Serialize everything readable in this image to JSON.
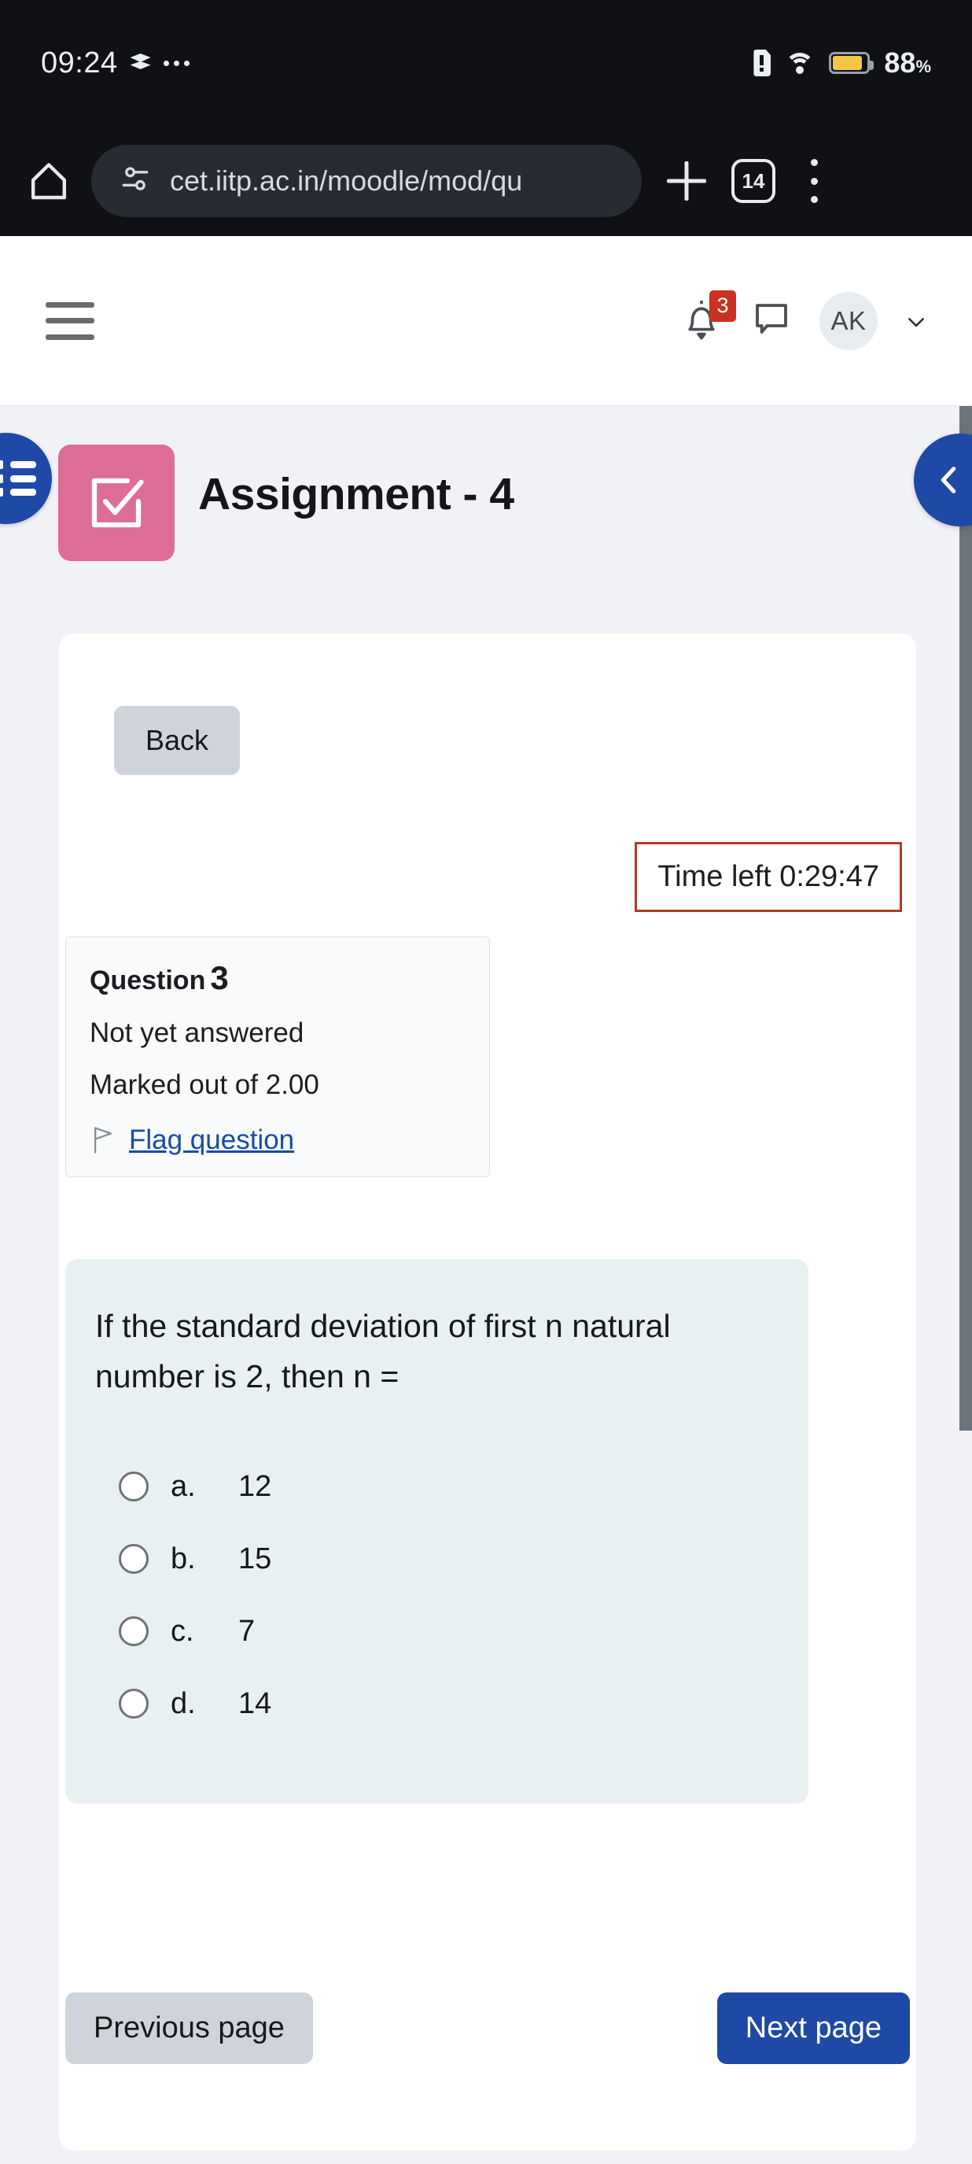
{
  "status_bar": {
    "clock": "09:24",
    "battery_percent": "88",
    "percent_symbol": "%",
    "icons": [
      "stack-icon",
      "more-dots-icon",
      "sim-alert-icon",
      "wifi-icon",
      "battery-icon"
    ]
  },
  "browser": {
    "home_icon": "home-icon",
    "site_settings_icon": "site-settings-icon",
    "url": "cet.iitp.ac.in/moodle/mod/qu",
    "new_tab_icon": "plus-icon",
    "tab_count": "14",
    "overflow_icon": "more-vertical-icon"
  },
  "moodle_header": {
    "menu_icon": "hamburger-icon",
    "notification_icon": "bell-icon",
    "notification_count": "3",
    "messages_icon": "chat-bubble-icon",
    "avatar_initials": "AK",
    "dropdown_icon": "chevron-down-icon"
  },
  "drawers": {
    "left_toggle_icon": "list-icon",
    "right_toggle_icon": "chevron-left-icon"
  },
  "page": {
    "activity_icon": "quiz-checkbox-icon",
    "title": "Assignment - 4"
  },
  "quiz": {
    "back_label": "Back",
    "time_left_label": "Time left 0:29:47",
    "info": {
      "question_word": "Question",
      "question_number": "3",
      "state": "Not yet answered",
      "marks": "Marked out of 2.00",
      "flag_icon": "flag-icon",
      "flag_label": "Flag question"
    },
    "question_text": "If the standard deviation of first n natural number is 2, then n =",
    "options": [
      {
        "letter": "a.",
        "text": "12",
        "selected": false
      },
      {
        "letter": "b.",
        "text": "15",
        "selected": false
      },
      {
        "letter": "c.",
        "text": "7",
        "selected": false
      },
      {
        "letter": "d.",
        "text": "14",
        "selected": false
      }
    ],
    "prev_label": "Previous page",
    "next_label": "Next page"
  },
  "colors": {
    "brand_blue": "#1f49a6",
    "quiz_icon_pink": "#dd6d97",
    "timer_border": "#b03a28",
    "badge_red": "#ca3120",
    "question_card_bg": "#e9f0f2",
    "page_bg": "#f1f2f6",
    "battery_yellow": "#f2c744"
  }
}
